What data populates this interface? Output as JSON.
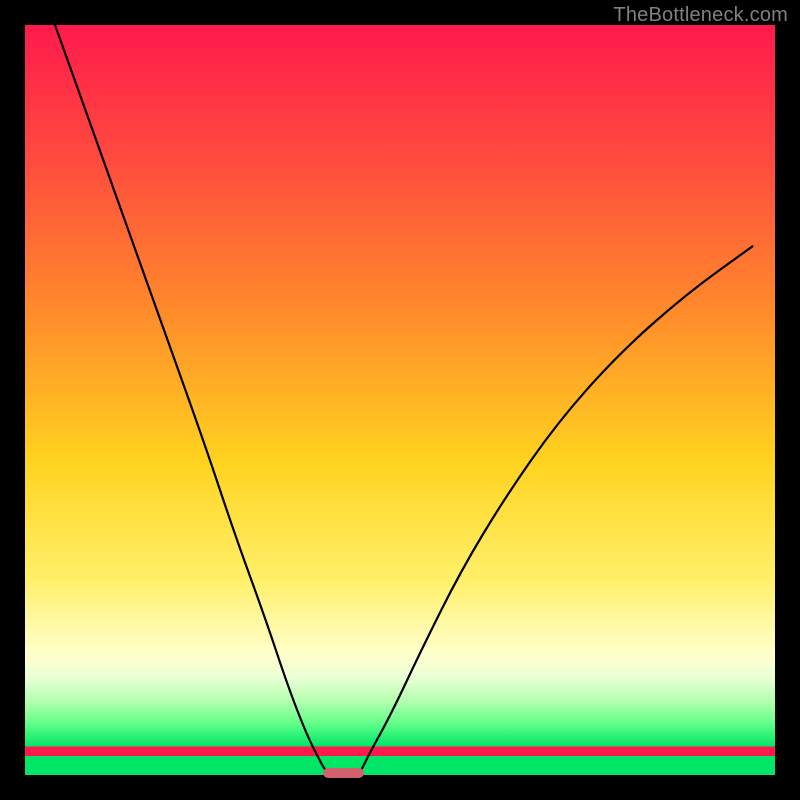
{
  "watermark": "TheBottleneck.com",
  "chart_data": {
    "type": "area",
    "title": "",
    "xlabel": "",
    "ylabel": "",
    "xlim": [
      0,
      1
    ],
    "ylim": [
      0,
      1
    ],
    "gradient_stops": [
      {
        "pos": 0.0,
        "color": "#ff1a4d",
        "meaning": "high bottleneck"
      },
      {
        "pos": 0.18,
        "color": "#ff4b3e"
      },
      {
        "pos": 0.38,
        "color": "#ff8a2b"
      },
      {
        "pos": 0.58,
        "color": "#ffd21f"
      },
      {
        "pos": 0.74,
        "color": "#fff06a"
      },
      {
        "pos": 0.84,
        "color": "#ffffcc"
      },
      {
        "pos": 0.87,
        "color": "#e9ffd6"
      },
      {
        "pos": 0.9,
        "color": "#b6ffb0"
      },
      {
        "pos": 0.93,
        "color": "#66ff8a"
      },
      {
        "pos": 1.0,
        "color": "#00e667",
        "meaning": "no bottleneck"
      }
    ],
    "curve_note": "Two nearly-vertical cusp branches meeting at a single minimum on the x-axis; left branch starts at top-left corner and sweeps down-right, right branch rises from the same cusp toward ~0.70 height at the right edge.",
    "series": [
      {
        "name": "left-branch",
        "x": [
          0.04,
          0.09,
          0.14,
          0.19,
          0.24,
          0.28,
          0.32,
          0.35,
          0.375,
          0.395,
          0.405
        ],
        "y": [
          1.0,
          0.86,
          0.72,
          0.58,
          0.44,
          0.32,
          0.21,
          0.12,
          0.055,
          0.015,
          0.0
        ]
      },
      {
        "name": "right-branch",
        "x": [
          0.445,
          0.46,
          0.49,
          0.53,
          0.58,
          0.64,
          0.71,
          0.79,
          0.88,
          0.97
        ],
        "y": [
          0.0,
          0.03,
          0.085,
          0.17,
          0.27,
          0.37,
          0.47,
          0.56,
          0.64,
          0.705
        ]
      }
    ],
    "cusp_minimum_x": 0.425,
    "marker": {
      "x_center": 0.425,
      "width_frac": 0.055,
      "color": "#d0626b"
    }
  },
  "colors": {
    "page_bg": "#000000",
    "curve": "#000000",
    "watermark": "#808080"
  }
}
